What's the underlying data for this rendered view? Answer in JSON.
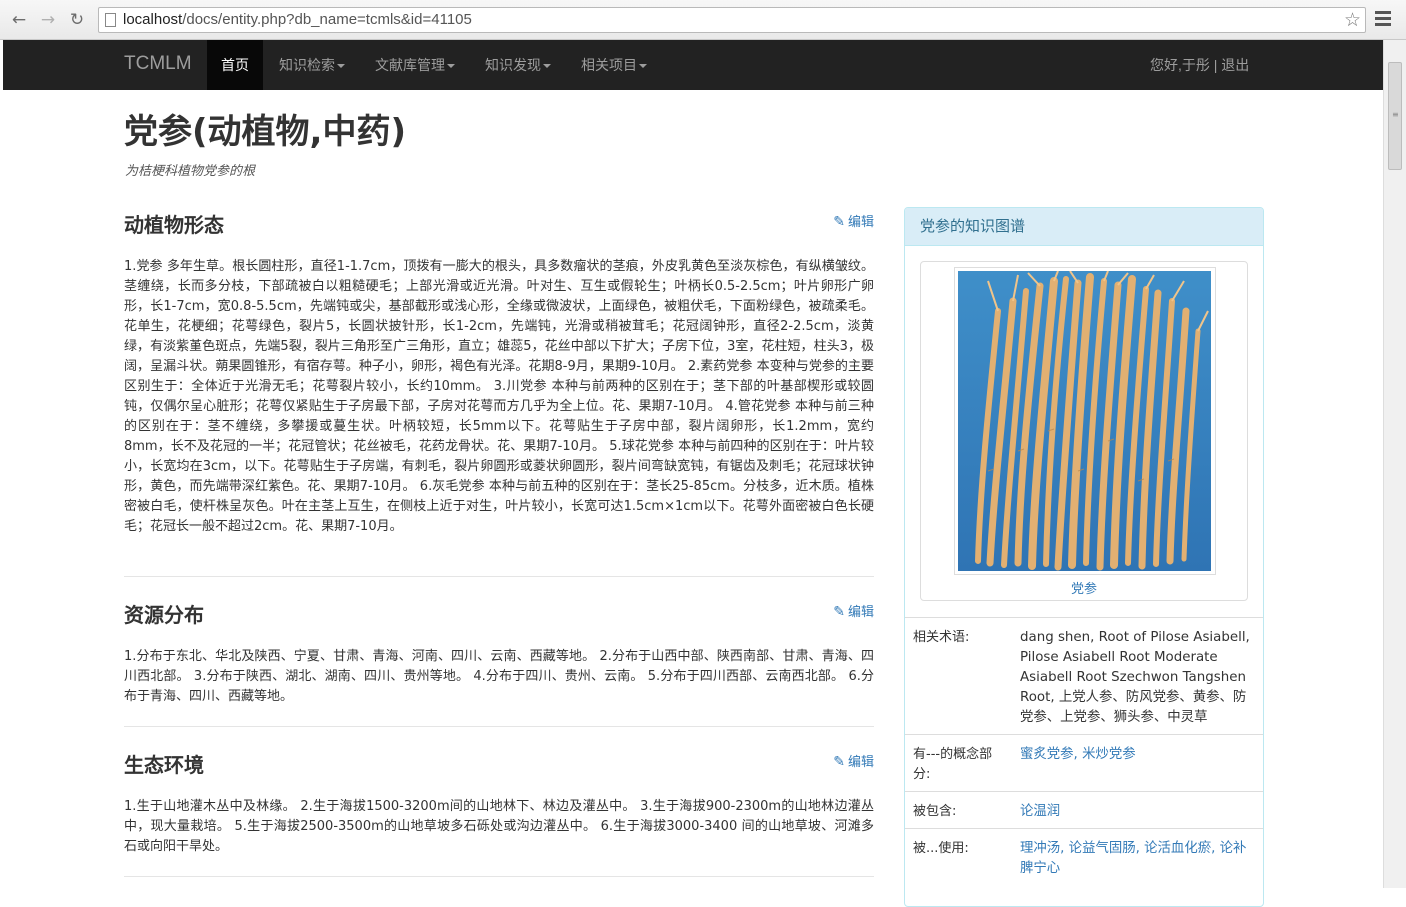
{
  "browser": {
    "back_icon": "arrow-left",
    "forward_icon": "arrow-right",
    "reload_icon": "reload",
    "url_host": "localhost",
    "url_path": "/docs/entity.php?db_name=tcmls&id=41105"
  },
  "navbar": {
    "brand": "TCMLM",
    "items": [
      {
        "label": "首页"
      },
      {
        "label": "知识检索"
      },
      {
        "label": "文献库管理"
      },
      {
        "label": "知识发现"
      },
      {
        "label": "相关项目"
      }
    ],
    "user": "您好,于彤 | 退出"
  },
  "entity": {
    "title": "党参(动植物,中药)",
    "subtitle": "为桔梗科植物党参的根"
  },
  "sections": [
    {
      "heading": "动植物形态",
      "edit": "编辑",
      "text": "1.党参 多年生草。根长圆柱形，直径1-1.7cm，顶拨有一膨大的根头，具多数瘤状的茎痕，外皮乳黄色至淡灰棕色，有纵横皱纹。茎缠绕，长而多分枝，下部疏被白以粗糙硬毛；上部光滑或近光滑。叶对生、互生或假轮生；叶柄长0.5-2.5cm；叶片卵形广卵形，长1-7cm，宽0.8-5.5cm，先端钝或尖，基部截形或浅心形，全缘或微波状，上面绿色，被粗伏毛，下面粉绿色，被疏柔毛。花单生，花梗细；花萼绿色，裂片5，长圆状披针形，长1-2cm，先端钝，光滑或稍被茸毛；花冠阔钟形，直径2-2.5cm，淡黄绿，有淡紫堇色斑点，先端5裂，裂片三角形至广三角形，直立；雄蕊5，花丝中部以下扩大；子房下位，3室，花柱短，柱头3，极阔，呈漏斗状。蒴果圆锥形，有宿存萼。种子小，卵形，褐色有光泽。花期8-9月，果期9-10月。 2.素药党参 本变种与党参的主要区别生于：全体近于光滑无毛；花萼裂片较小，长约10mm。 3.川党参 本种与前两种的区别在于；茎下部的叶基部楔形或较圆钝，仅偶尔呈心脏形；花萼仅紧贴生于子房最下部，子房对花萼而方几乎为全上位。花、果期7-10月。 4.管花党参 本种与前三种的区别在于：茎不缠绕，多攀援或蔓生状。叶柄较短，长5mm以下。花萼贴生于子房中部，裂片阔卵形，长1.2mm，宽约8mm，长不及花冠的一半；花冠管状；花丝被毛，花药龙骨状。花、果期7-10月。 5.球花党参 本种与前四种的区别在于：叶片较小，长宽均在3cm，以下。花萼贴生于子房端，有刺毛，裂片卵圆形或菱状卵圆形，裂片间弯缺宽钝，有锯齿及刺毛；花冠球状钟形，黄色，而先端带深红紫色。花、果期7-10月。 6.灰毛党参 本种与前五种的区别在于：茎长25-85cm。分枝多，近木质。植株密被白毛，使杆株呈灰色。叶在主茎上互生，在侧枝上近于对生，叶片较小，长宽可达1.5cm×1cm以下。花萼外面密被白色长硬毛；花冠长一般不超过2cm。花、果期7-10月。"
    },
    {
      "heading": "资源分布",
      "edit": "编辑",
      "text": "1.分布于东北、华北及陕西、宁夏、甘肃、青海、河南、四川、云南、西藏等地。 2.分布于山西中部、陕西南部、甘肃、青海、四川西北部。 3.分布于陕西、湖北、湖南、四川、贵州等地。 4.分布于四川、贵州、云南。 5.分布于四川西部、云南西北部。 6.分布于青海、四川、西藏等地。"
    },
    {
      "heading": "生态环境",
      "edit": "编辑",
      "text": "1.生于山地灌木丛中及林缘。 2.生于海拔1500-3200m间的山地林下、林边及灌丛中。 3.生于海拔900-2300m的山地林边灌丛中，现大量栽培。 5.生于海拔2500-3500m的山地草坡多石砾处或沟边灌丛中。 6.生于海拔3000-3400 间的山地草坡、河滩多石或向阳干旱处。"
    }
  ],
  "panel": {
    "title": "党参的知识图谱",
    "image_caption": "党参",
    "properties": [
      {
        "key": "相关术语:",
        "value": "dang shen, Root of Pilose Asiabell, Pilose Asiabell Root Moderate Asiabell Root Szechwon Tangshen Root, 上党人参、防风党参、黄参、防党参、上党参、狮头参、中灵草"
      },
      {
        "key": "有---的概念部分:",
        "value": "蜜炙党参, 米炒党参"
      },
      {
        "key": "被包含:",
        "value": "论温润"
      },
      {
        "key": "被...使用:",
        "value": "理冲汤, 论益气固肠, 论活血化瘀, 论补脾宁心"
      }
    ]
  },
  "colors": {
    "navbar_bg": "#222222",
    "link": "#337ab7",
    "panel_head_bg": "#d9edf7",
    "panel_head_text": "#31708f"
  }
}
